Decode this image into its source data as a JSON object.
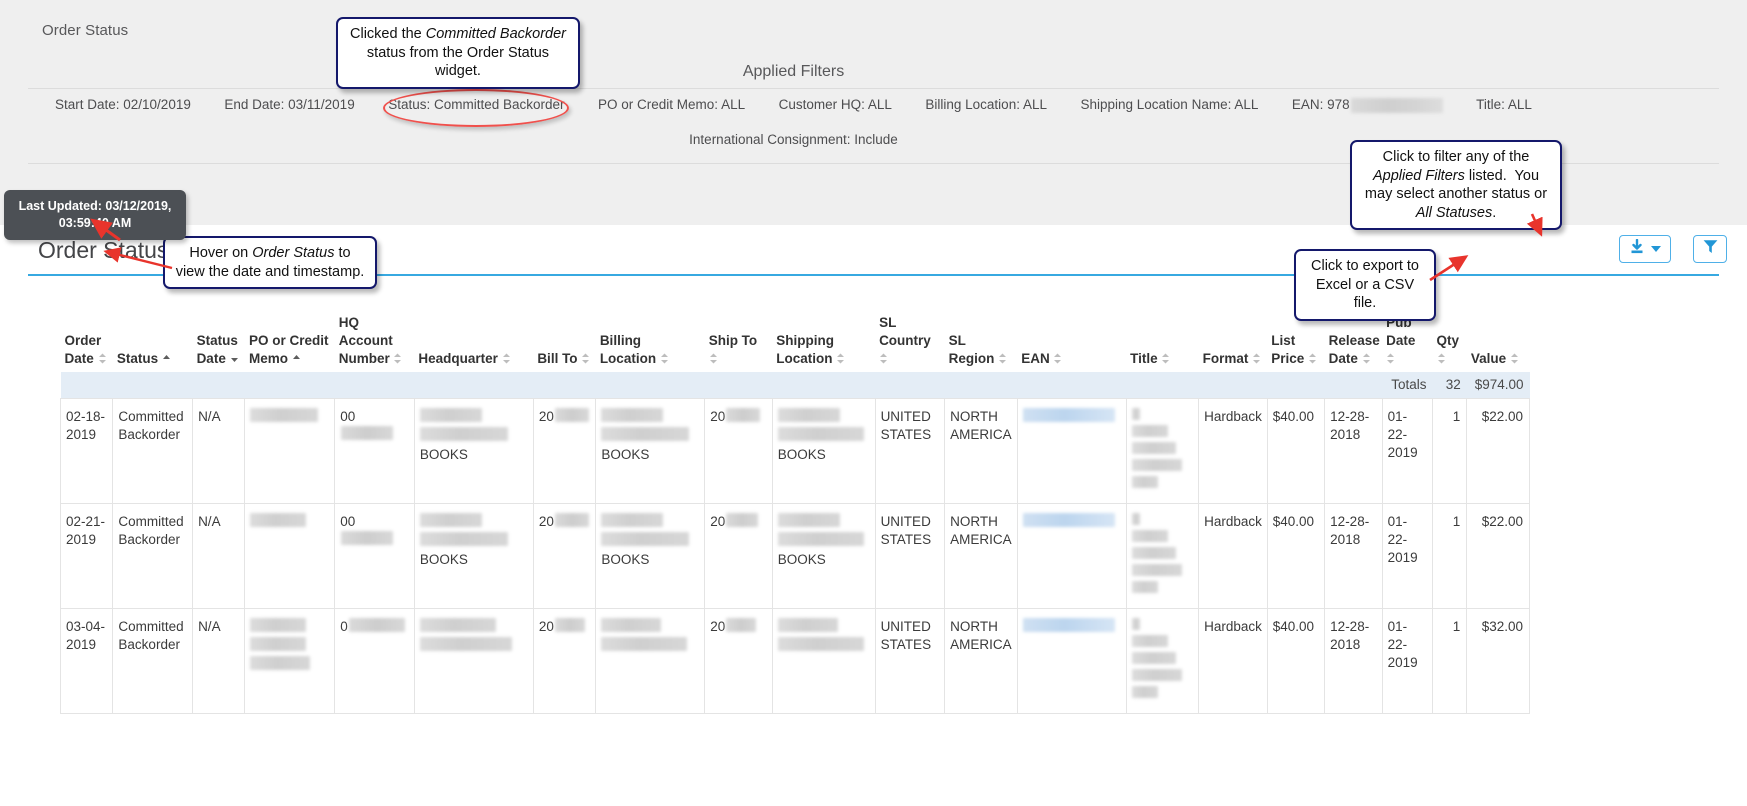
{
  "breadcrumb": "Order Status",
  "applied_filters": {
    "title": "Applied Filters",
    "items": [
      {
        "label": "Start Date: 02/10/2019",
        "redacted": false
      },
      {
        "label": "End Date: 03/11/2019",
        "redacted": false
      },
      {
        "label": "Status: Committed Backorder",
        "redacted": false,
        "highlighted": true
      },
      {
        "label": "PO or Credit Memo: ALL",
        "redacted": false
      },
      {
        "label": "Customer HQ: ALL",
        "redacted": false
      },
      {
        "label": "Billing Location: ALL",
        "redacted": false
      },
      {
        "label": "Shipping Location Name: ALL",
        "redacted": false
      },
      {
        "label": "EAN: 978",
        "redacted": true
      },
      {
        "label": "Title: ALL",
        "redacted": false
      }
    ],
    "second_row": "International Consignment: Include"
  },
  "widget": {
    "title": "Order Status",
    "tooltip": "Last Updated: 03/12/2019, 03:59:40 AM",
    "export_button_label": "export-excel-csv",
    "filter_button_label": "filter"
  },
  "callouts": [
    {
      "id": "c1",
      "line1": "Clicked the ",
      "em1": "Committed Backorder",
      "line2": "status from the Order Status widget."
    },
    {
      "id": "c2",
      "line1": "Click to filter any of the ",
      "em1": "Applied",
      "line2": "Filters",
      "line3": " listed.  You may select",
      "line4": "another status or ",
      "em2": "All Statuses",
      "line5": "."
    },
    {
      "id": "c3",
      "line1": "Hover on ",
      "em1": "Order Status",
      "line2": " to view",
      "line3": "the date and timestamp."
    },
    {
      "id": "c4",
      "line1": "Click to export to",
      "line2": "Excel or a CSV file."
    }
  ],
  "table": {
    "columns": [
      {
        "label": "Order Date",
        "sort": "none"
      },
      {
        "label": "Status",
        "sort": "asc"
      },
      {
        "label": "Status Date",
        "sort": "desc"
      },
      {
        "label": "PO or Credit Memo",
        "sort": "asc"
      },
      {
        "label": "HQ Account Number",
        "sort": "none"
      },
      {
        "label": "Headquarter",
        "sort": "none"
      },
      {
        "label": "Bill To",
        "sort": "none"
      },
      {
        "label": "Billing Location",
        "sort": "none"
      },
      {
        "label": "Ship To",
        "sort": "none"
      },
      {
        "label": "Shipping Location",
        "sort": "none"
      },
      {
        "label": "SL Country",
        "sort": "none"
      },
      {
        "label": "SL Region",
        "sort": "none"
      },
      {
        "label": "EAN",
        "sort": "none"
      },
      {
        "label": "Title",
        "sort": "none"
      },
      {
        "label": "Format",
        "sort": "none"
      },
      {
        "label": "List Price",
        "sort": "none"
      },
      {
        "label": "Release Date",
        "sort": "none"
      },
      {
        "label": "Pub Date",
        "sort": "none"
      },
      {
        "label": "Qty",
        "sort": "none"
      },
      {
        "label": "Value",
        "sort": "none"
      }
    ],
    "totals": {
      "label": "Totals",
      "qty": "32",
      "value": "$974.00"
    },
    "rows": [
      {
        "order_date": "02-18-2019",
        "status": "Committed Backorder",
        "status_date": "N/A",
        "po_memo": "",
        "hq_account_prefix": "00",
        "headquarter_suffix": "BOOKS",
        "bill_to_prefix": "20",
        "billing_location_suffix": "BOOKS",
        "ship_to_prefix": "20",
        "shipping_location_suffix": "BOOKS",
        "sl_country": "UNITED STATES",
        "sl_region": "NORTH AMERICA",
        "ean": "",
        "title": "",
        "format": "Hardback",
        "list_price": "$40.00",
        "release_date": "12-28-2018",
        "pub_date": "01-22-2019",
        "qty": "1",
        "value": "$22.00"
      },
      {
        "order_date": "02-21-2019",
        "status": "Committed Backorder",
        "status_date": "N/A",
        "po_memo": "",
        "hq_account_prefix": "00",
        "headquarter_suffix": "BOOKS",
        "bill_to_prefix": "20",
        "billing_location_suffix": "BOOKS",
        "ship_to_prefix": "20",
        "shipping_location_suffix": "BOOKS",
        "sl_country": "UNITED STATES",
        "sl_region": "NORTH AMERICA",
        "ean": "",
        "title": "",
        "format": "Hardback",
        "list_price": "$40.00",
        "release_date": "12-28-2018",
        "pub_date": "01-22-2019",
        "qty": "1",
        "value": "$22.00"
      },
      {
        "order_date": "03-04-2019",
        "status": "Committed Backorder",
        "status_date": "N/A",
        "po_memo": "",
        "hq_account_prefix": "0",
        "headquarter_suffix": "",
        "bill_to_prefix": "20",
        "billing_location_suffix": "",
        "ship_to_prefix": "20",
        "shipping_location_suffix": "",
        "sl_country": "UNITED STATES",
        "sl_region": "NORTH AMERICA",
        "ean": "",
        "title": "",
        "format": "Hardback",
        "list_price": "$40.00",
        "release_date": "12-28-2018",
        "pub_date": "01-22-2019",
        "qty": "1",
        "value": "$32.00"
      }
    ]
  },
  "colors": {
    "accent_blue": "#37a9e1",
    "callout_border": "#14186b",
    "highlight_red": "#f0504c",
    "tooltip_bg": "#4c5055",
    "totals_bg": "#e4edf6"
  }
}
